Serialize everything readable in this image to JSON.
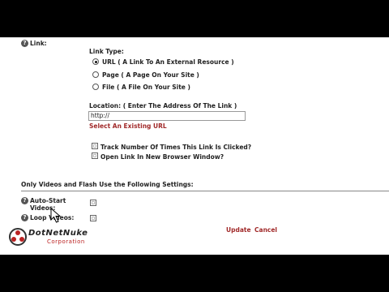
{
  "link": {
    "label": "Link:"
  },
  "link_type": {
    "label": "Link Type:",
    "options": [
      {
        "label": "URL ( A Link To An External Resource )",
        "selected": true
      },
      {
        "label": "Page ( A Page On Your Site )",
        "selected": false
      },
      {
        "label": "File ( A File On Your Site )",
        "selected": false
      }
    ]
  },
  "location": {
    "label": "Location: ( Enter The Address Of The Link )",
    "value": "http://",
    "select_existing": "Select An Existing URL"
  },
  "checkboxes": {
    "track": "Track Number Of Times This Link Is Clicked?",
    "new_window": "Open Link In New Browser Window?"
  },
  "section": {
    "title": "Only Videos and Flash Use the Following Settings:"
  },
  "settings": {
    "auto_start": "Auto-Start Videos:",
    "loop": "Loop Videos:"
  },
  "actions": {
    "update": "Update",
    "cancel": "Cancel"
  },
  "brand": {
    "name": "DotNetNuke",
    "sub": "Corporation"
  },
  "colors": {
    "link_red": "#a12a2a",
    "help_icon": "#555555"
  }
}
